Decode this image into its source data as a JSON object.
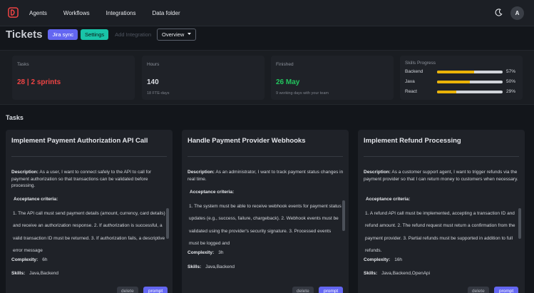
{
  "nav": {
    "items": [
      "Agents",
      "Workflows",
      "Integrations",
      "Data folder"
    ]
  },
  "user": {
    "avatar_initial": "A"
  },
  "header": {
    "title": "Tickets",
    "jira_label": "Jira sync",
    "settings_label": "Settings",
    "add_integration_label": "Add Integration",
    "overview_label": "Overview"
  },
  "stats": {
    "tasks": {
      "label": "Tasks",
      "value": "28 | 2 sprints"
    },
    "hours": {
      "label": "Hours",
      "value": "140",
      "sub": "18 FTE-days"
    },
    "finished": {
      "label": "Finished",
      "value": "26 May",
      "sub": "9 working days with your team"
    },
    "skills": {
      "label": "Skills Progress",
      "items": [
        {
          "name": "Backend",
          "percent": "57%",
          "fraction": 0.57
        },
        {
          "name": "Java",
          "percent": "50%",
          "fraction": 0.5
        },
        {
          "name": "React",
          "percent": "29%",
          "fraction": 0.29
        }
      ]
    }
  },
  "tasks_heading": "Tasks",
  "cards": [
    {
      "title": "Implement Payment Authorization API Call",
      "description_label": "Description:",
      "description": "As a user, I want to connect safely to the API to call for payment authorization so that transactions can be validated before processing.",
      "criteria_label": "Acceptance criteria:",
      "criteria": "1. The API call must send payment details (amount, currency, card details) and receive an authorization response. 2. If authorization is successful, a valid transaction ID must be returned. 3. If authorization fails, a descriptive error message",
      "complexity_label": "Complexity:",
      "complexity": "6h",
      "skills_label": "Skills:",
      "skills": "Java,Backend",
      "delete_label": "delete",
      "prompt_label": "prompt"
    },
    {
      "title": "Handle Payment Provider Webhooks",
      "description_label": "Description:",
      "description": "As an administrator, I want to track payment status changes in real time.",
      "criteria_label": "Acceptance criteria:",
      "criteria": "1. The system must be able to receive webhook events for payment status updates (e.g., success, failure, chargeback). 2. Webhook events must be validated using the provider's security signature. 3. Processed events must be logged and",
      "complexity_label": "Complexity:",
      "complexity": "3h",
      "skills_label": "Skills:",
      "skills": "Java,Backend",
      "delete_label": "delete",
      "prompt_label": "prompt"
    },
    {
      "title": "Implement Refund Processing",
      "description_label": "Description:",
      "description": "As a customer support agent, I want to trigger refunds via the payment provider so that I can return money to customers when necessary.",
      "criteria_label": "Acceptance criteria:",
      "criteria": "1. A refund API call must be implemented, accepting a transaction ID and refund amount. 2. The refund request must return a confirmation from the payment provider. 3. Partial refunds must be supported in addition to full refunds.",
      "complexity_label": "Complexity:",
      "complexity": "16h",
      "skills_label": "Skills:",
      "skills": "Java,Backend,OpenApi",
      "delete_label": "delete",
      "prompt_label": "prompt"
    }
  ],
  "colors": {
    "accent": "#6366f1",
    "teal": "#19c4a8",
    "red": "#ef4444",
    "green": "#22c55e",
    "progress": "#eab308"
  }
}
